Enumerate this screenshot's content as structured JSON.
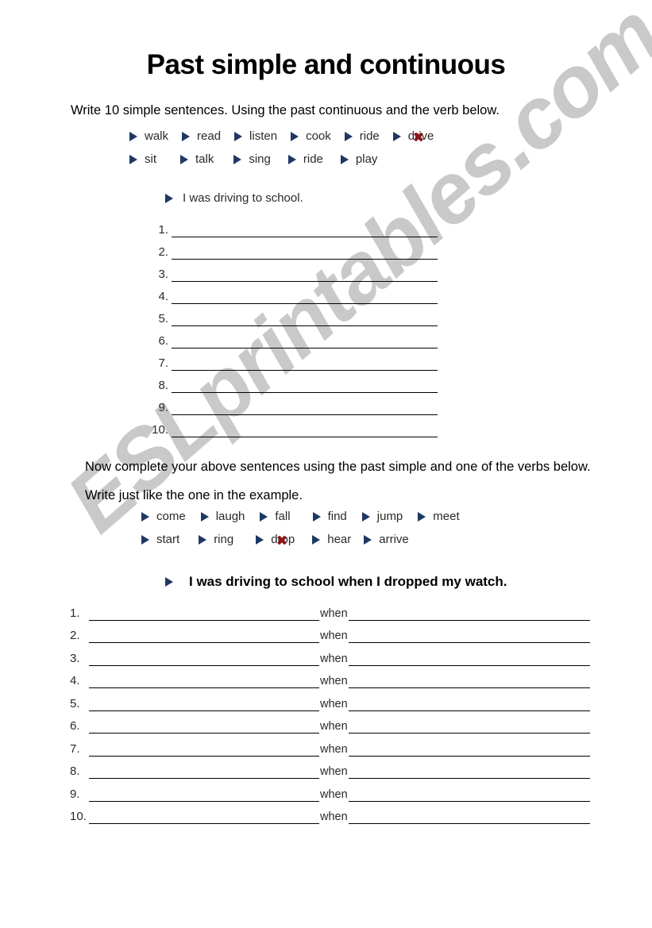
{
  "watermark": {
    "text": "ESLprintables.com"
  },
  "title": "Past simple and continuous",
  "section1": {
    "instruction": "Write 10 simple sentences.  Using the past continuous and the verb below.",
    "verbs_row1": [
      "walk",
      "read",
      "listen",
      "cook",
      "ride",
      "drive"
    ],
    "verbs_row2": [
      "sit",
      "talk",
      "sing",
      "ride",
      "play"
    ],
    "marked_verb": "drive",
    "example": "I was driving to school.",
    "numbers": [
      "1.",
      "2.",
      "3.",
      "4.",
      "5.",
      "6.",
      "7.",
      "8.",
      "9.",
      "10."
    ]
  },
  "section2": {
    "instruction": "Now complete your above sentences using the past simple and one of the verbs below.  Write just like the one in the example.",
    "verbs_row1": [
      "come",
      "laugh",
      "fall",
      "find",
      "jump",
      "meet"
    ],
    "verbs_row2": [
      "start",
      "ring",
      "drop",
      "hear",
      "arrive"
    ],
    "marked_verb": "drop",
    "example": "I was driving to school when I dropped my watch.",
    "connector": "when",
    "numbers": [
      "1.",
      "2.",
      "3.",
      "4.",
      "5.",
      "6.",
      "7.",
      "8.",
      "9.",
      "10."
    ]
  },
  "colors": {
    "bullet": "#1f3864",
    "mark": "#8c1616",
    "watermark": "#c9c9c9",
    "text": "#000000"
  }
}
